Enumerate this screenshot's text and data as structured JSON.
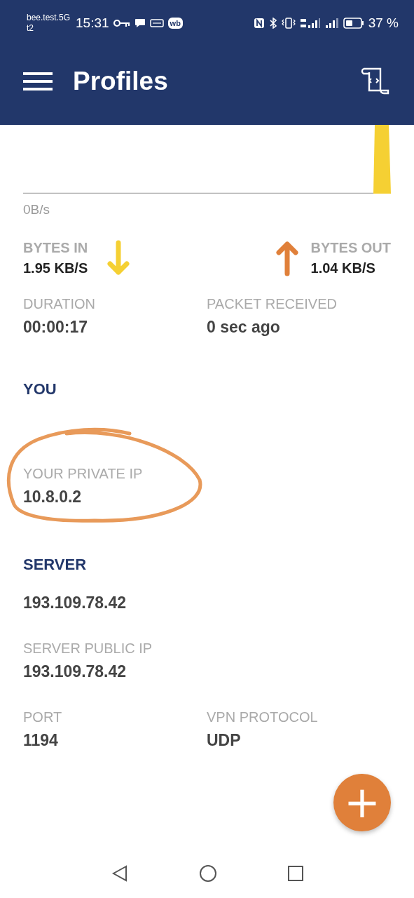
{
  "status_bar": {
    "carrier": "bee.test.5G",
    "carrier_line2": "t2",
    "time": "15:31",
    "app_badge": "wb",
    "battery": "37 %"
  },
  "app_bar": {
    "title": "Profiles"
  },
  "graph": {
    "axis_label": "0B/s"
  },
  "traffic": [
    {
      "kind": "in",
      "label": "BYTES IN",
      "value": "1.95 KB/S"
    },
    {
      "kind": "out",
      "label": "BYTES OUT",
      "value": "1.04 KB/S"
    }
  ],
  "stats": [
    {
      "label": "DURATION",
      "value": "00:00:17"
    },
    {
      "label": "PACKET RECEIVED",
      "value": "0 sec ago"
    }
  ],
  "you": {
    "heading": "YOU",
    "private_ip_label": "YOUR PRIVATE IP",
    "private_ip": "10.8.0.2"
  },
  "server": {
    "heading": "SERVER",
    "host": "193.109.78.42",
    "public_ip_label": "SERVER PUBLIC IP",
    "public_ip": "193.109.78.42",
    "details": [
      {
        "label": "PORT",
        "value": "1194"
      },
      {
        "label": "VPN PROTOCOL",
        "value": "UDP"
      }
    ]
  },
  "fab": {
    "symbol": "+"
  }
}
